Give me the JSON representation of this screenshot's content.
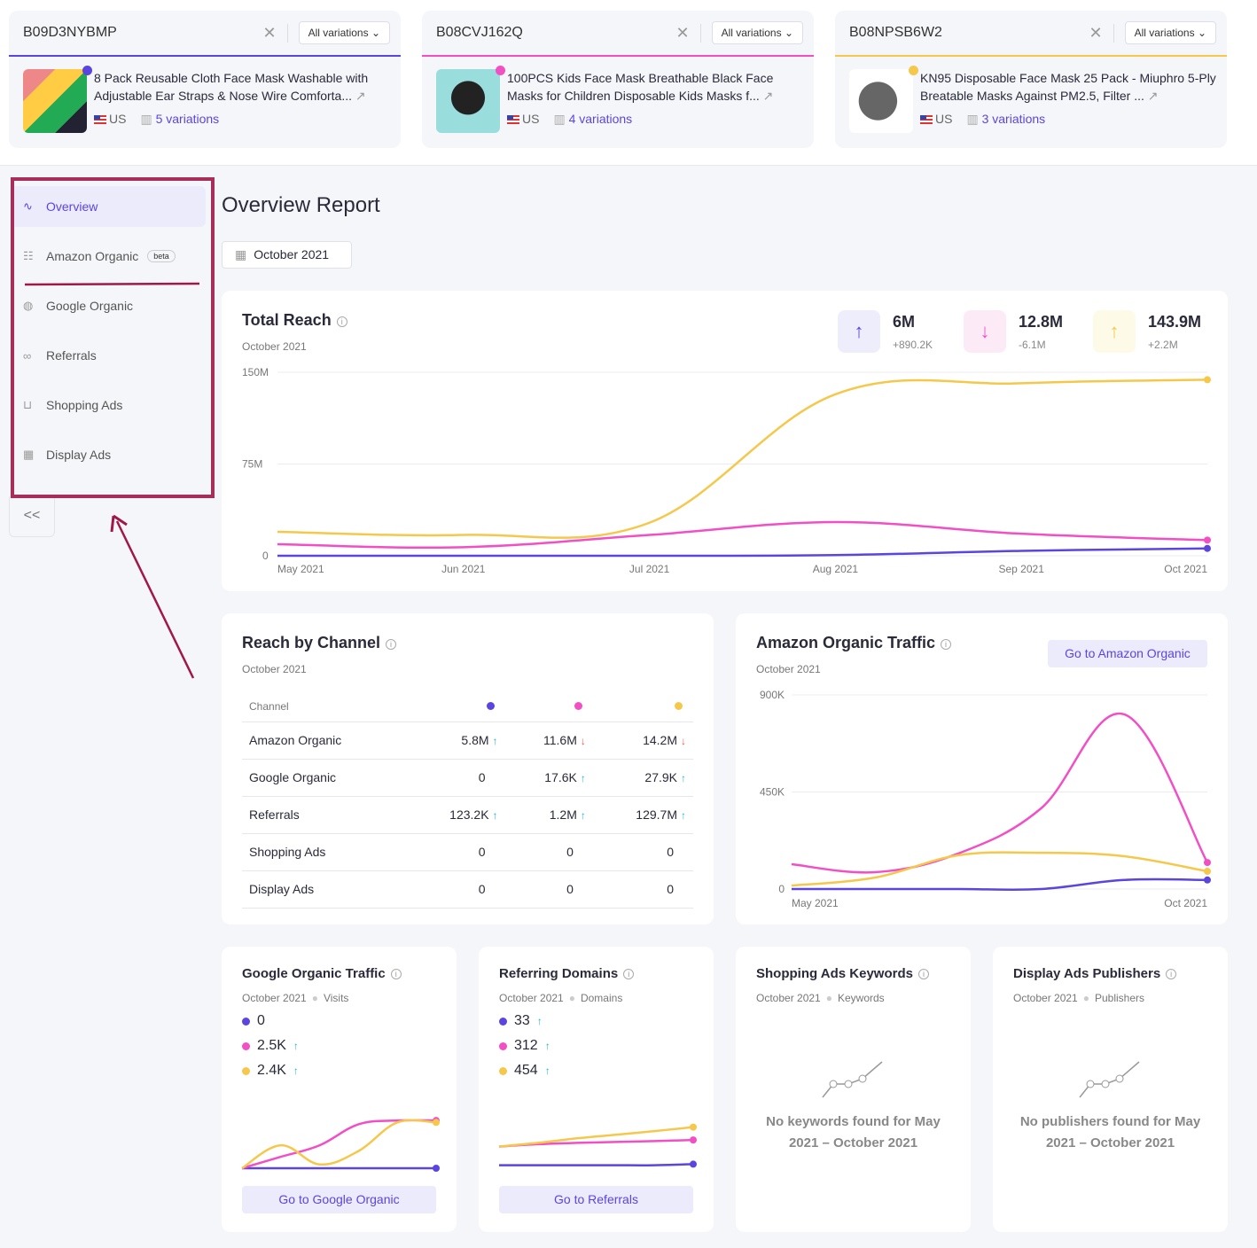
{
  "colors": {
    "purple": "#5b45e0",
    "pink": "#f24fc5",
    "yellow": "#f5c84c"
  },
  "products": [
    {
      "asin": "B09D3NYBMP",
      "variations_select": "All variations",
      "title": "8 Pack Reusable Cloth Face Mask Washable with Adjustable Ear Straps & Nose Wire Comforta...",
      "country": "US",
      "variations": "5 variations"
    },
    {
      "asin": "B08CVJ162Q",
      "variations_select": "All variations",
      "title": "100PCS Kids Face Mask Breathable Black Face Masks for Children Disposable Kids Masks f...",
      "country": "US",
      "variations": "4 variations"
    },
    {
      "asin": "B08NPSB6W2",
      "variations_select": "All variations",
      "title": "KN95 Disposable Face Mask 25 Pack - Miuphro 5-Ply Breatable Masks Against PM2.5, Filter ...",
      "country": "US",
      "variations": "3 variations"
    }
  ],
  "sidebar": {
    "items": [
      {
        "label": "Overview",
        "icon": "line-chart-icon"
      },
      {
        "label": "Amazon Organic",
        "icon": "list-icon",
        "badge": "beta"
      },
      {
        "label": "Google Organic",
        "icon": "google-icon"
      },
      {
        "label": "Referrals",
        "icon": "link-icon"
      },
      {
        "label": "Shopping Ads",
        "icon": "cart-icon"
      },
      {
        "label": "Display Ads",
        "icon": "layout-icon"
      }
    ],
    "collapse": "<<"
  },
  "page": {
    "title": "Overview Report",
    "date": "October 2021"
  },
  "total_reach": {
    "title": "Total Reach",
    "subtitle": "October 2021",
    "stats": [
      {
        "value": "6M",
        "delta": "+890.2K",
        "dir": "up"
      },
      {
        "value": "12.8M",
        "delta": "-6.1M",
        "dir": "down"
      },
      {
        "value": "143.9M",
        "delta": "+2.2M",
        "dir": "up"
      }
    ]
  },
  "reach_by_channel": {
    "title": "Reach by Channel",
    "subtitle": "October 2021",
    "header": "Channel",
    "rows": [
      {
        "channel": "Amazon Organic",
        "v": [
          "5.8M",
          "11.6M",
          "14.2M"
        ],
        "t": [
          "up",
          "down",
          "down"
        ]
      },
      {
        "channel": "Google Organic",
        "v": [
          "0",
          "17.6K",
          "27.9K"
        ],
        "t": [
          "",
          "up",
          "up"
        ]
      },
      {
        "channel": "Referrals",
        "v": [
          "123.2K",
          "1.2M",
          "129.7M"
        ],
        "t": [
          "up",
          "up",
          "up"
        ]
      },
      {
        "channel": "Shopping Ads",
        "v": [
          "0",
          "0",
          "0"
        ],
        "t": [
          "",
          "",
          ""
        ]
      },
      {
        "channel": "Display Ads",
        "v": [
          "0",
          "0",
          "0"
        ],
        "t": [
          "",
          "",
          ""
        ]
      }
    ]
  },
  "amazon_traffic": {
    "title": "Amazon Organic Traffic",
    "subtitle": "October 2021",
    "button": "Go to Amazon Organic"
  },
  "google_traffic": {
    "title": "Google Organic Traffic",
    "subtitle": "October 2021",
    "metric": "Visits",
    "values": [
      "0",
      "2.5K",
      "2.4K"
    ],
    "trends": [
      "",
      "up",
      "up"
    ],
    "button": "Go to Google Organic"
  },
  "referring_domains": {
    "title": "Referring Domains",
    "subtitle": "October 2021",
    "metric": "Domains",
    "values": [
      "33",
      "312",
      "454"
    ],
    "trends": [
      "up",
      "up",
      "up"
    ],
    "button": "Go to Referrals"
  },
  "shopping_keywords": {
    "title": "Shopping Ads Keywords",
    "subtitle": "October 2021",
    "metric": "Keywords",
    "empty": "No keywords found for May 2021 – October 2021"
  },
  "display_publishers": {
    "title": "Display Ads Publishers",
    "subtitle": "October 2021",
    "metric": "Publishers",
    "empty": "No publishers found for May 2021 – October 2021"
  },
  "chart_data": [
    {
      "type": "line",
      "id": "total-reach",
      "categories": [
        "May 2021",
        "Jun 2021",
        "Jul 2021",
        "Aug 2021",
        "Sep 2021",
        "Oct 2021"
      ],
      "yticks": [
        "0",
        "75M",
        "150M"
      ],
      "ylim": [
        0,
        150000000
      ],
      "series": [
        {
          "color": "#5b45e0",
          "values": [
            0,
            0,
            0,
            500000,
            4000000,
            6000000
          ]
        },
        {
          "color": "#f24fc5",
          "values": [
            9400000,
            7000000,
            17000000,
            27500000,
            18000000,
            12800000
          ]
        },
        {
          "color": "#f5c84c",
          "values": [
            19600000,
            17000000,
            27000000,
            132000000,
            141000000,
            143900000
          ]
        }
      ]
    },
    {
      "type": "line",
      "id": "amazon-traffic",
      "categories": [
        "May 2021",
        "Jun 2021",
        "Jul 2021",
        "Aug 2021",
        "Sep 2021",
        "Oct 2021"
      ],
      "xticks": [
        "May 2021",
        "Oct 2021"
      ],
      "yticks": [
        "0",
        "450K",
        "900K"
      ],
      "ylim": [
        0,
        900000
      ],
      "series": [
        {
          "color": "#5b45e0",
          "values": [
            0,
            0,
            0,
            0,
            42000,
            42000
          ]
        },
        {
          "color": "#f24fc5",
          "values": [
            115000,
            78000,
            164000,
            374000,
            810000,
            123000
          ]
        },
        {
          "color": "#f5c84c",
          "values": [
            16000,
            53000,
            156000,
            168000,
            152000,
            82000
          ]
        }
      ]
    },
    {
      "type": "line",
      "id": "google-spark",
      "series": [
        {
          "color": "#5b45e0",
          "values": [
            0,
            0,
            0,
            0,
            0,
            0
          ]
        },
        {
          "color": "#f24fc5",
          "values": [
            0,
            0.6,
            1.2,
            2.3,
            2.5,
            2.5
          ]
        },
        {
          "color": "#f5c84c",
          "values": [
            0,
            1.2,
            0.2,
            0.9,
            2.4,
            2.4
          ]
        }
      ]
    },
    {
      "type": "line",
      "id": "domains-spark",
      "series": [
        {
          "color": "#5b45e0",
          "values": [
            33,
            33,
            33,
            33,
            33,
            45
          ]
        },
        {
          "color": "#f24fc5",
          "values": [
            240,
            265,
            280,
            290,
            300,
            312
          ]
        },
        {
          "color": "#f5c84c",
          "values": [
            240,
            280,
            330,
            370,
            410,
            454
          ]
        }
      ]
    }
  ]
}
